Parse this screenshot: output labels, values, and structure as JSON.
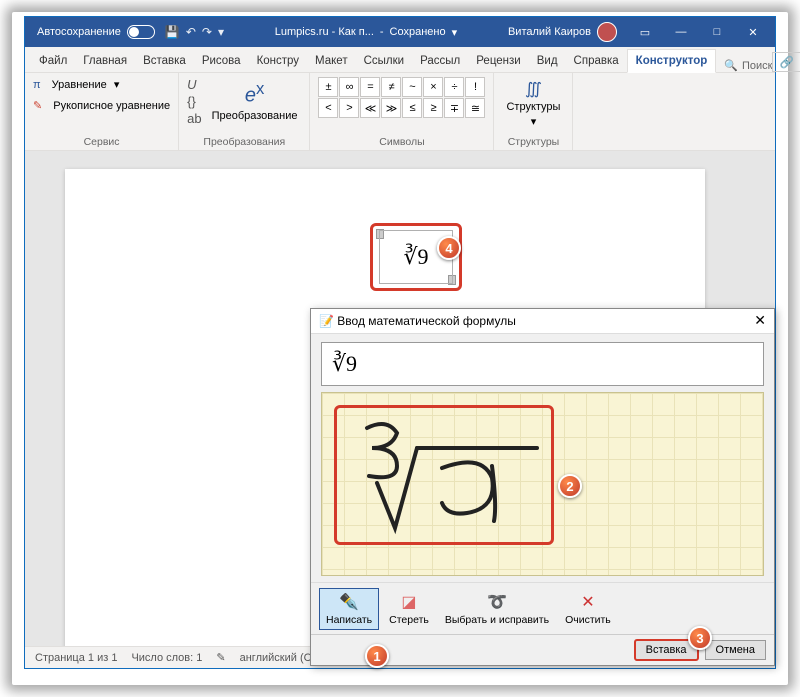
{
  "titlebar": {
    "autosave": "Автосохранение",
    "docname": "Lumpics.ru - Как п...",
    "saved": "Сохранено",
    "username": "Виталий Каиров"
  },
  "tabs": {
    "file": "Файл",
    "home": "Главная",
    "insert": "Вставка",
    "draw": "Рисова",
    "design": "Констру",
    "layout": "Макет",
    "references": "Ссылки",
    "mailings": "Рассыл",
    "review": "Рецензи",
    "view": "Вид",
    "help": "Справка",
    "constructor": "Конструктор"
  },
  "search_placeholder": "Поиск",
  "ribbon": {
    "service": {
      "equation": "Уравнение",
      "ink": "Рукописное уравнение",
      "label": "Сервис"
    },
    "transform": {
      "convert": "Преобразование",
      "label": "Преобразования"
    },
    "symbols": {
      "label": "Символы",
      "cells": [
        "±",
        "∞",
        "=",
        "≠",
        "~",
        "×",
        "÷",
        "!",
        "<",
        ">",
        "≪",
        "≫",
        "≤",
        "≥",
        "∓",
        "≅"
      ]
    },
    "structures": {
      "btn": "Структуры",
      "label": "Структуры"
    }
  },
  "equation_display": "∛9",
  "statusbar": {
    "page": "Страница 1 из 1",
    "words": "Число слов: 1",
    "lang": "английский (США)"
  },
  "dialog": {
    "title": "Ввод математической формулы",
    "preview": "∛9",
    "tools": {
      "write": "Написать",
      "erase": "Стереть",
      "select": "Выбрать и исправить",
      "clear": "Очистить"
    },
    "insert": "Вставка",
    "cancel": "Отмена"
  },
  "callouts": {
    "c1": "1",
    "c2": "2",
    "c3": "3",
    "c4": "4"
  }
}
